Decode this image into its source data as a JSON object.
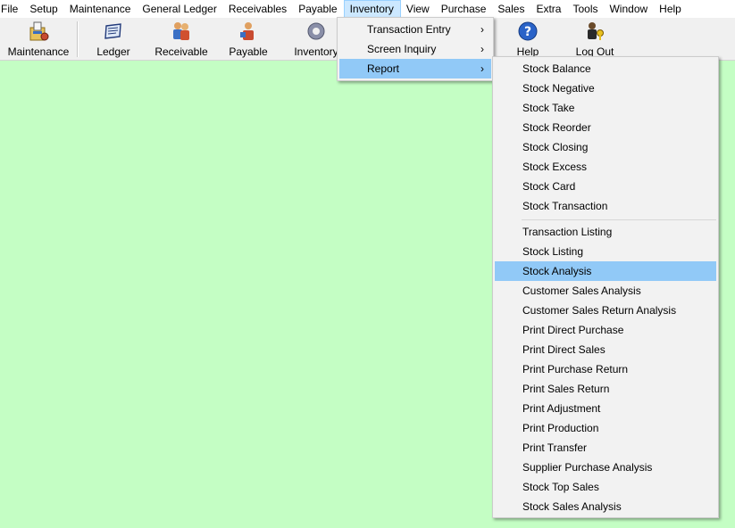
{
  "menubar": {
    "items": [
      "File",
      "Setup",
      "Maintenance",
      "General Ledger",
      "Receivables",
      "Payable",
      "Inventory",
      "View",
      "Purchase",
      "Sales",
      "Extra",
      "Tools",
      "Window",
      "Help"
    ],
    "open_item": "Inventory"
  },
  "toolbar": {
    "maintenance": "Maintenance",
    "ledger": "Ledger",
    "receivable": "Receivable",
    "payable": "Payable",
    "inventory": "Inventory",
    "help": "Help",
    "logout": "Log Out"
  },
  "inventory_menu": {
    "items": [
      "Transaction Entry",
      "Screen Inquiry",
      "Report"
    ],
    "arrow": "›",
    "highlighted": "Report"
  },
  "report_menu": {
    "group1": [
      "Stock Balance",
      "Stock Negative",
      "Stock Take",
      "Stock Reorder",
      "Stock Closing",
      "Stock Excess",
      "Stock Card",
      "Stock Transaction"
    ],
    "group2": [
      "Transaction Listing",
      "Stock Listing",
      "Stock Analysis",
      "Customer Sales Analysis",
      "Customer Sales Return Analysis",
      "Print Direct Purchase",
      "Print Direct Sales",
      "Print Purchase Return",
      "Print Sales Return",
      "Print Adjustment",
      "Print Production",
      "Print Transfer",
      "Supplier Purchase Analysis",
      "Stock Top Sales",
      "Stock Sales Analysis"
    ],
    "highlighted": "Stock Analysis"
  },
  "colors": {
    "workspace": "#c4fec4",
    "highlight": "#91c9f7",
    "menubar_open": "#cce8ff"
  }
}
